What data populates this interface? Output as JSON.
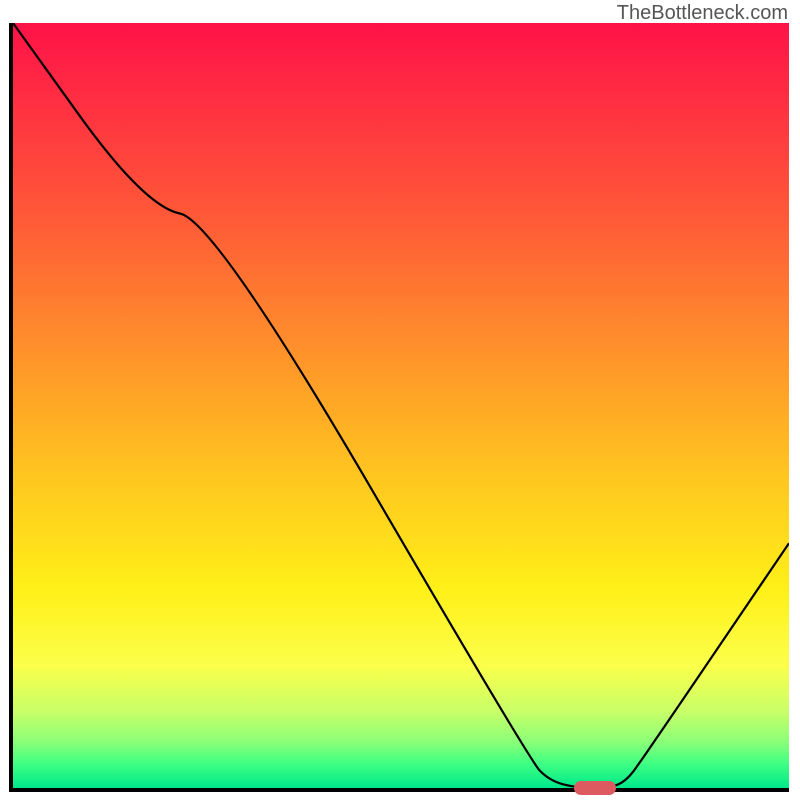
{
  "watermark": "TheBottleneck.com",
  "chart_data": {
    "type": "line",
    "title": "",
    "xlabel": "",
    "ylabel": "",
    "x_range": [
      0,
      100
    ],
    "y_range": [
      0,
      100
    ],
    "background": {
      "type": "vertical-gradient",
      "stops": [
        {
          "pos": 0.0,
          "color": "#ff1248"
        },
        {
          "pos": 0.26,
          "color": "#ff5b37"
        },
        {
          "pos": 0.48,
          "color": "#ffa227"
        },
        {
          "pos": 0.6,
          "color": "#ffc81f"
        },
        {
          "pos": 0.74,
          "color": "#fff018"
        },
        {
          "pos": 0.84,
          "color": "#fbff4a"
        },
        {
          "pos": 0.9,
          "color": "#c8ff68"
        },
        {
          "pos": 0.94,
          "color": "#8aff78"
        },
        {
          "pos": 0.97,
          "color": "#3aff83"
        },
        {
          "pos": 1.0,
          "color": "#00e78a"
        }
      ]
    },
    "series": [
      {
        "name": "bottleneck-curve",
        "color": "#000000",
        "points": [
          {
            "x": 0.0,
            "y": 100.0
          },
          {
            "x": 17.0,
            "y": 76.0
          },
          {
            "x": 26.0,
            "y": 74.2
          },
          {
            "x": 66.6,
            "y": 3.6
          },
          {
            "x": 69.2,
            "y": 0.9
          },
          {
            "x": 72.8,
            "y": 0.0
          },
          {
            "x": 76.9,
            "y": 0.0
          },
          {
            "x": 79.0,
            "y": 0.9
          },
          {
            "x": 81.0,
            "y": 3.6
          },
          {
            "x": 100.0,
            "y": 32.0
          }
        ]
      }
    ],
    "highlight": {
      "x": 75.0,
      "y": 0.0,
      "color": "#dc5a60"
    }
  }
}
